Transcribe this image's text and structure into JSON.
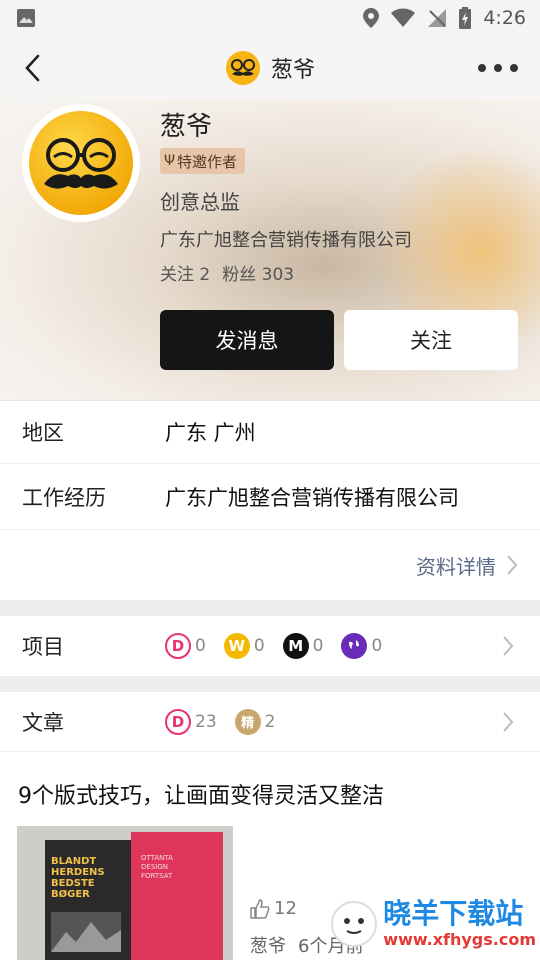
{
  "status_bar": {
    "time": "4:26"
  },
  "nav": {
    "title": "葱爷"
  },
  "profile": {
    "name": "葱爷",
    "badge": "特邀作者",
    "job_title": "创意总监",
    "company": "广东广旭整合营销传播有限公司",
    "following_label": "关注 2",
    "followers_label": "粉丝 303"
  },
  "buttons": {
    "message": "发消息",
    "follow": "关注"
  },
  "info": {
    "region_label": "地区",
    "region_value": "广东 广州",
    "work_label": "工作经历",
    "work_value": "广东广旭整合营销传播有限公司",
    "detail_link": "资料详情"
  },
  "projects": {
    "label": "项目",
    "stats": [
      {
        "icon": "D",
        "count": "0",
        "color": "#e8336f"
      },
      {
        "icon": "W",
        "count": "0",
        "color": "#f5b800"
      },
      {
        "icon": "M",
        "count": "0",
        "color": "#111111"
      },
      {
        "icon": "globe",
        "count": "0",
        "color": "#6a2bb8"
      }
    ]
  },
  "articles": {
    "label": "文章",
    "stats": [
      {
        "icon": "D",
        "count": "23",
        "color": "#e8336f"
      },
      {
        "icon": "精",
        "count": "2",
        "color": "#c9a66b"
      }
    ]
  },
  "article": {
    "title": "9个版式技巧，让画面变得灵活又整洁",
    "likes": "12",
    "author": "葱爷",
    "time": "6个月前",
    "thumb_text_left": "BLANDT\nHERDENS\nBEDSTE\nBØGER",
    "thumb_text_right": "OTTANTA\nDESIGN\nFORTSAT"
  },
  "watermark": {
    "text": "晓羊下载站",
    "url": "www.xfhygs.com"
  }
}
